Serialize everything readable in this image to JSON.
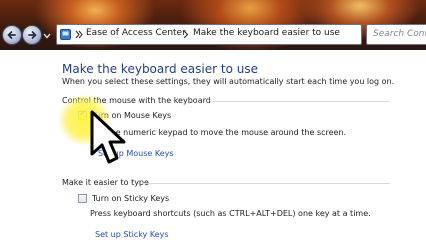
{
  "window": {
    "breadcrumb": [
      "Ease of Access Center",
      "Make the keyboard easier to use"
    ],
    "search_placeholder": "Search Control Panel"
  },
  "page": {
    "heading": "Make the keyboard easier to use",
    "intro": "When you select these settings, they will automatically start each time you log on."
  },
  "mouse_section": {
    "label": "Control the mouse with the keyboard",
    "option_label": "Turn on Mouse Keys",
    "checked": true,
    "description": "Use the numeric keypad to move the mouse around the screen.",
    "setup_link": "Set up Mouse Keys"
  },
  "typing_section": {
    "label": "Make it easier to type",
    "option_label": "Turn on Sticky Keys",
    "checked": false,
    "description": "Press keyboard shortcuts (such as CTRL+ALT+DEL) one key at a time.",
    "setup_link": "Set up Sticky Keys"
  },
  "colors": {
    "heading": "#1e3f8e",
    "link": "#1e4fc0",
    "highlight": "#fff03c"
  },
  "icons": [
    "back-arrow-icon",
    "forward-arrow-icon",
    "control-panel-icon",
    "mouse-pointer-cursor-icon"
  ]
}
